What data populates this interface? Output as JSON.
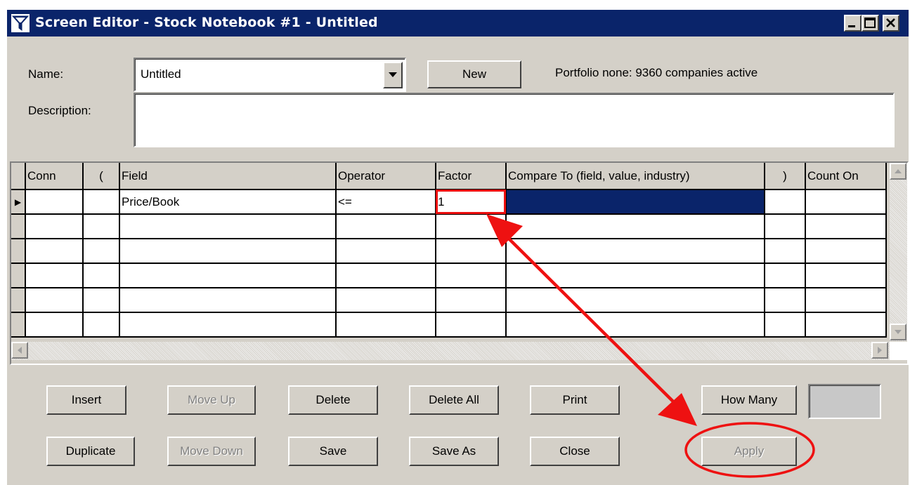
{
  "window": {
    "title": "Screen Editor - Stock Notebook #1 - Untitled",
    "controls": {
      "minimize": "_",
      "maximize": "□",
      "close": "×"
    }
  },
  "form": {
    "name_label": "Name:",
    "name_value": "Untitled",
    "new_button": "New",
    "portfolio_status": "Portfolio none: 9360 companies active",
    "description_label": "Description:",
    "description_value": ""
  },
  "grid": {
    "columns": [
      "Conn",
      "(",
      "Field",
      "Operator",
      "Factor",
      "Compare To (field, value, industry)",
      ")",
      "Count On"
    ],
    "rows": [
      [
        "",
        "",
        "Price/Book",
        "<=",
        "1",
        "",
        "",
        ""
      ],
      [
        "",
        "",
        "",
        "",
        "",
        "",
        "",
        ""
      ],
      [
        "",
        "",
        "",
        "",
        "",
        "",
        "",
        ""
      ],
      [
        "",
        "",
        "",
        "",
        "",
        "",
        "",
        ""
      ],
      [
        "",
        "",
        "",
        "",
        "",
        "",
        "",
        ""
      ],
      [
        "",
        "",
        "",
        "",
        "",
        "",
        "",
        ""
      ]
    ],
    "current_row_indicator": "▶"
  },
  "buttons": {
    "insert": "Insert",
    "move_up": "Move Up",
    "delete": "Delete",
    "delete_all": "Delete All",
    "print": "Print",
    "how_many": "How Many",
    "how_many_result": "",
    "duplicate": "Duplicate",
    "move_down": "Move Down",
    "save": "Save",
    "save_as": "Save As",
    "close": "Close",
    "apply": "Apply"
  },
  "colors": {
    "titlebar": "#0a246a",
    "face": "#d4d0c8",
    "annotation": "#ee1111",
    "selection": "#0a246a"
  },
  "icons": {
    "app": "filter-funnel-icon",
    "dropdown": "chevron-down-icon"
  }
}
